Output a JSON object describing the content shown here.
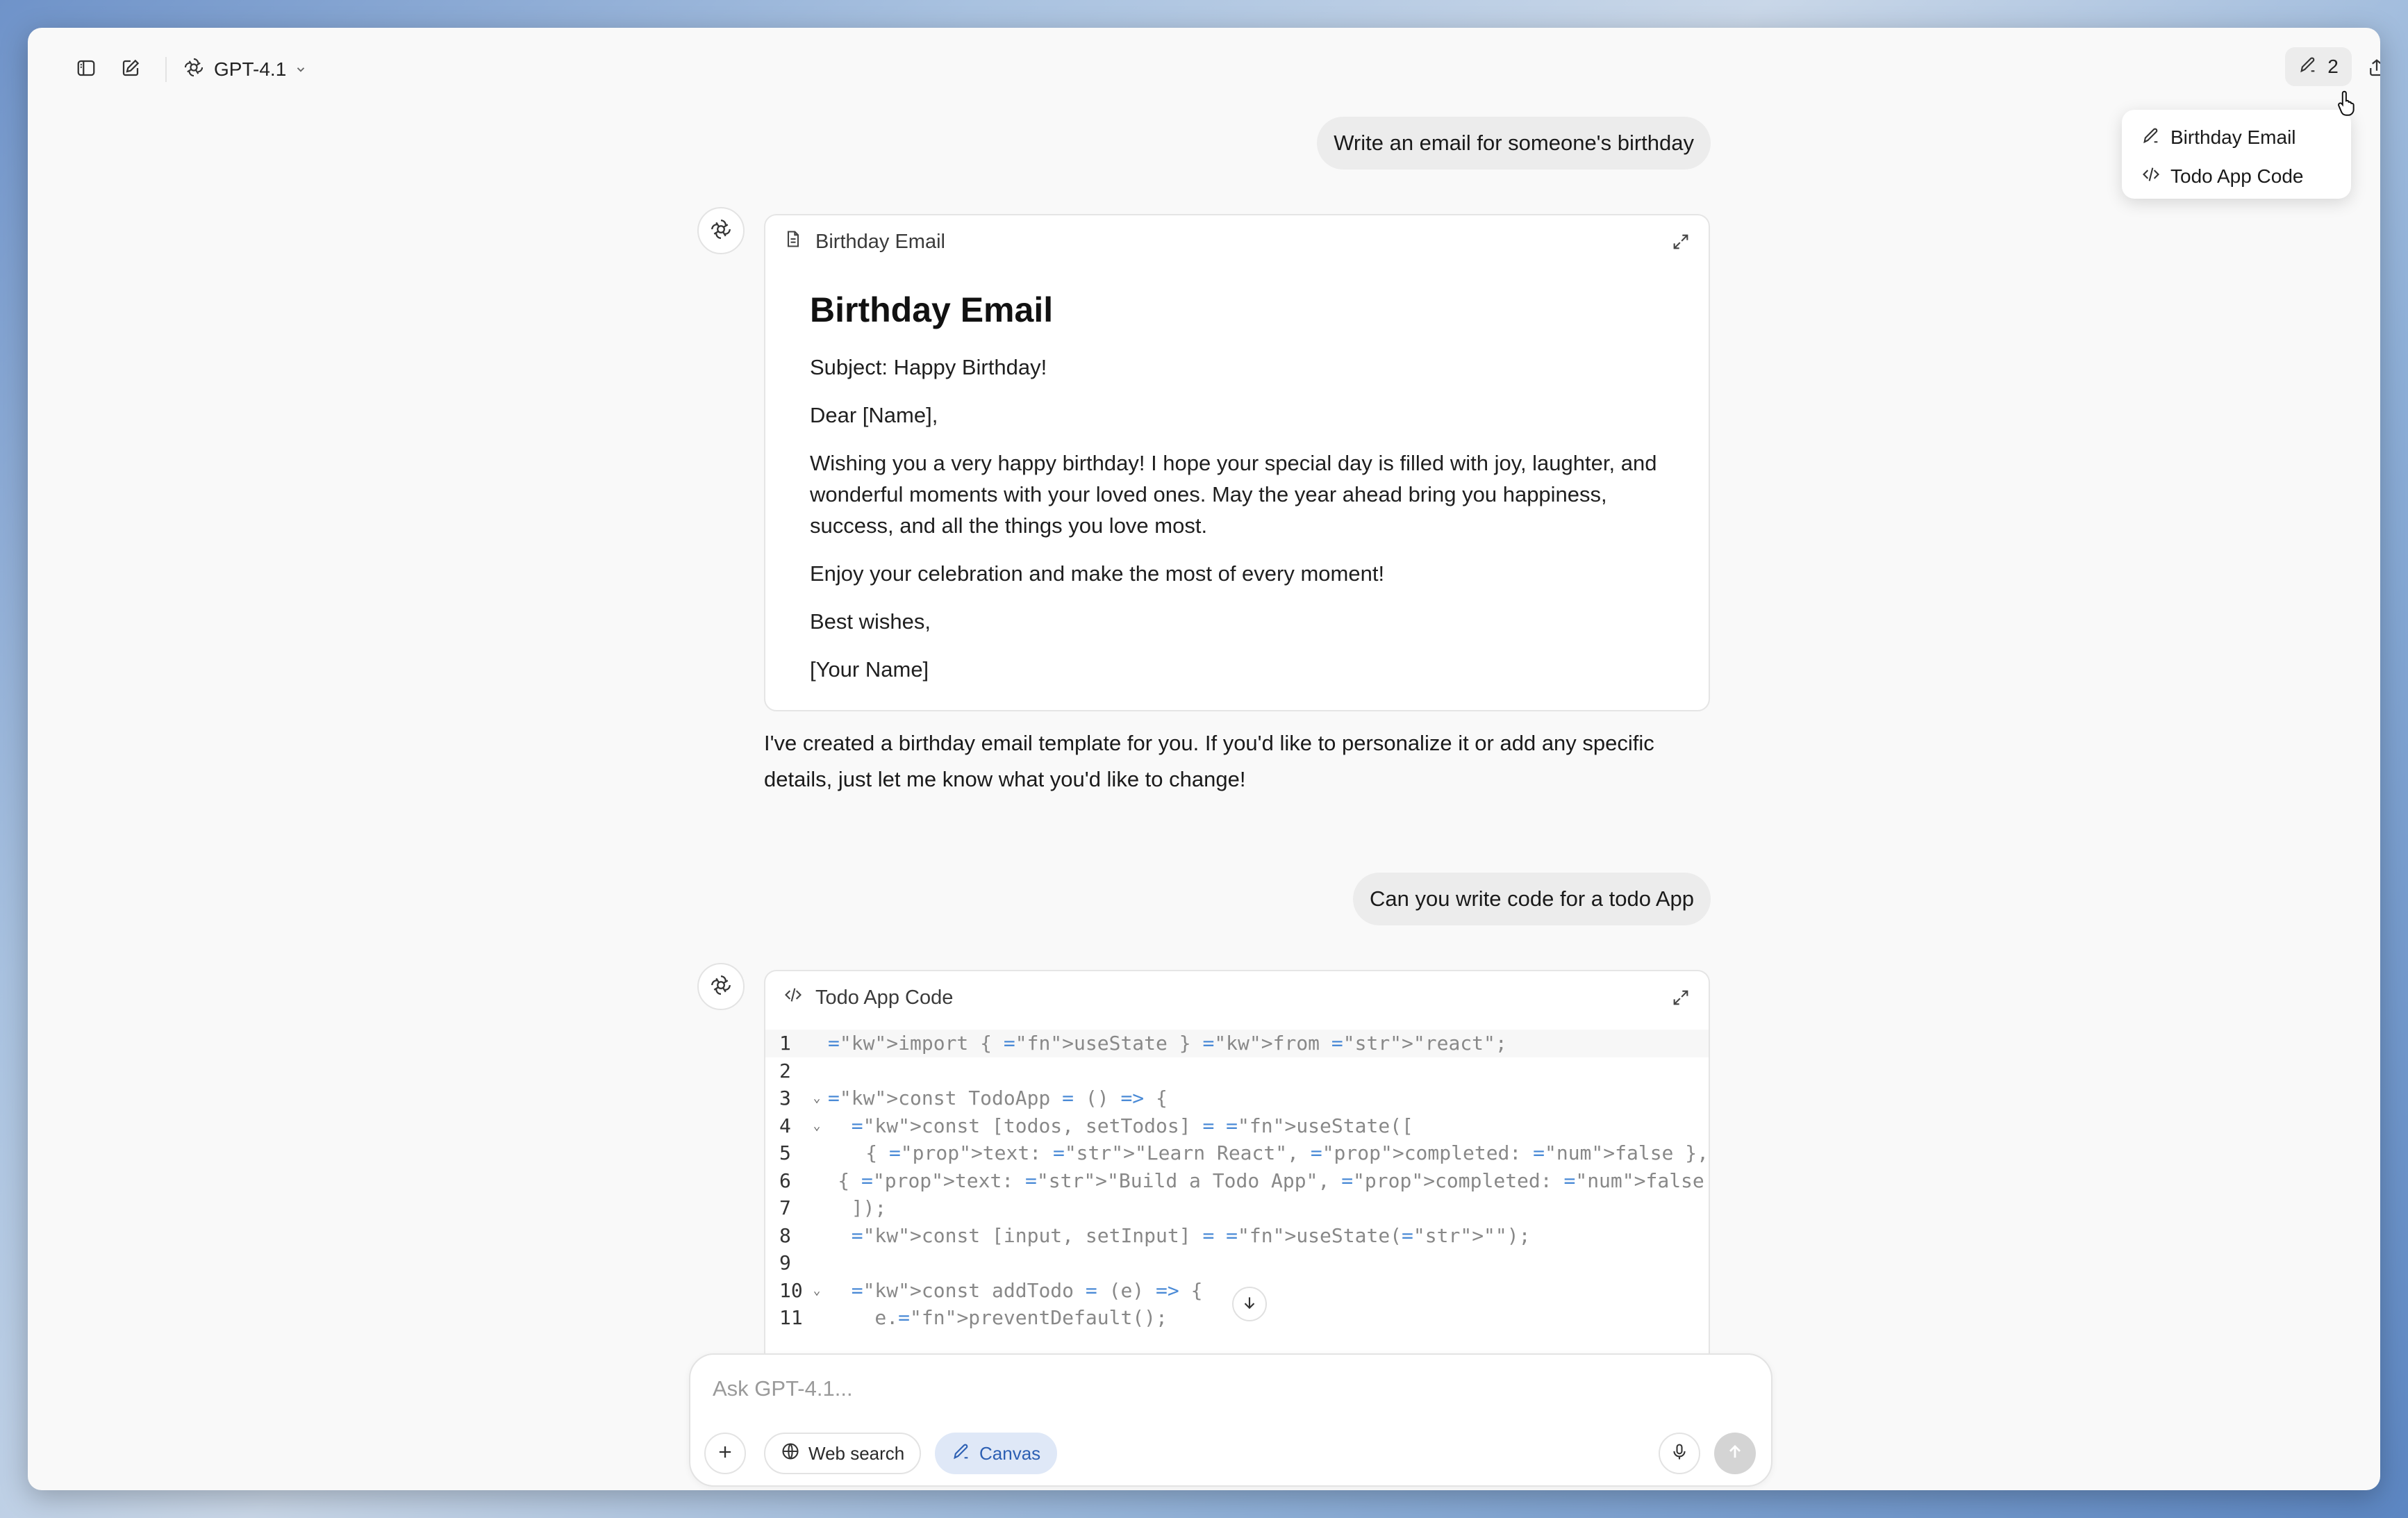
{
  "header": {
    "model_name": "GPT-4.1",
    "canvas_count": "2"
  },
  "canvas_menu": {
    "items": [
      {
        "label": "Birthday Email",
        "icon": "pencil-icon"
      },
      {
        "label": "Todo App Code",
        "icon": "code-icon"
      }
    ]
  },
  "conversation": {
    "user_message_1": "Write an email for someone's birthday",
    "email_card": {
      "title": "Birthday Email",
      "heading": "Birthday Email",
      "paragraphs": [
        "Subject: Happy Birthday!",
        "Dear [Name],",
        "Wishing you a very happy birthday! I hope your special day is filled with joy, laughter, and wonderful moments with your loved ones. May the year ahead bring you happiness, success, and all the things you love most.",
        "Enjoy your celebration and make the most of every moment!",
        "Best wishes,",
        "[Your Name]"
      ]
    },
    "assistant_reply_1": "I've created a birthday email template for you. If you'd like to personalize it or add any specific details, just let me know what you'd like to change!",
    "user_message_2": "Can you write code for a todo App",
    "code_card": {
      "title": "Todo App Code",
      "lines": [
        {
          "n": "1",
          "code": "import { useState } from \"react\";"
        },
        {
          "n": "2",
          "code": ""
        },
        {
          "n": "3",
          "code": "const TodoApp = () => {"
        },
        {
          "n": "4",
          "code": "  const [todos, setTodos] = useState(["
        },
        {
          "n": "5",
          "code": "    { text: \"Learn React\", completed: false },"
        },
        {
          "n": "6",
          "code": "    { text: \"Build a Todo App\", completed: false },"
        },
        {
          "n": "7",
          "code": "  ]);"
        },
        {
          "n": "8",
          "code": "  const [input, setInput] = useState(\"\");"
        },
        {
          "n": "9",
          "code": ""
        },
        {
          "n": "10",
          "code": "  const addTodo = (e) => {"
        },
        {
          "n": "11",
          "code": "    e.preventDefault();"
        }
      ]
    }
  },
  "composer": {
    "placeholder": "Ask GPT-4.1...",
    "web_search_label": "Web search",
    "canvas_label": "Canvas"
  },
  "colors": {
    "keyword": "#b36ad0",
    "string": "#7cae5b",
    "function": "#4a8ad6",
    "property": "#d45a5a",
    "boolean": "#d98a3f",
    "canvas_active_bg": "#dfe8f7",
    "canvas_active_text": "#2c5fb3"
  }
}
